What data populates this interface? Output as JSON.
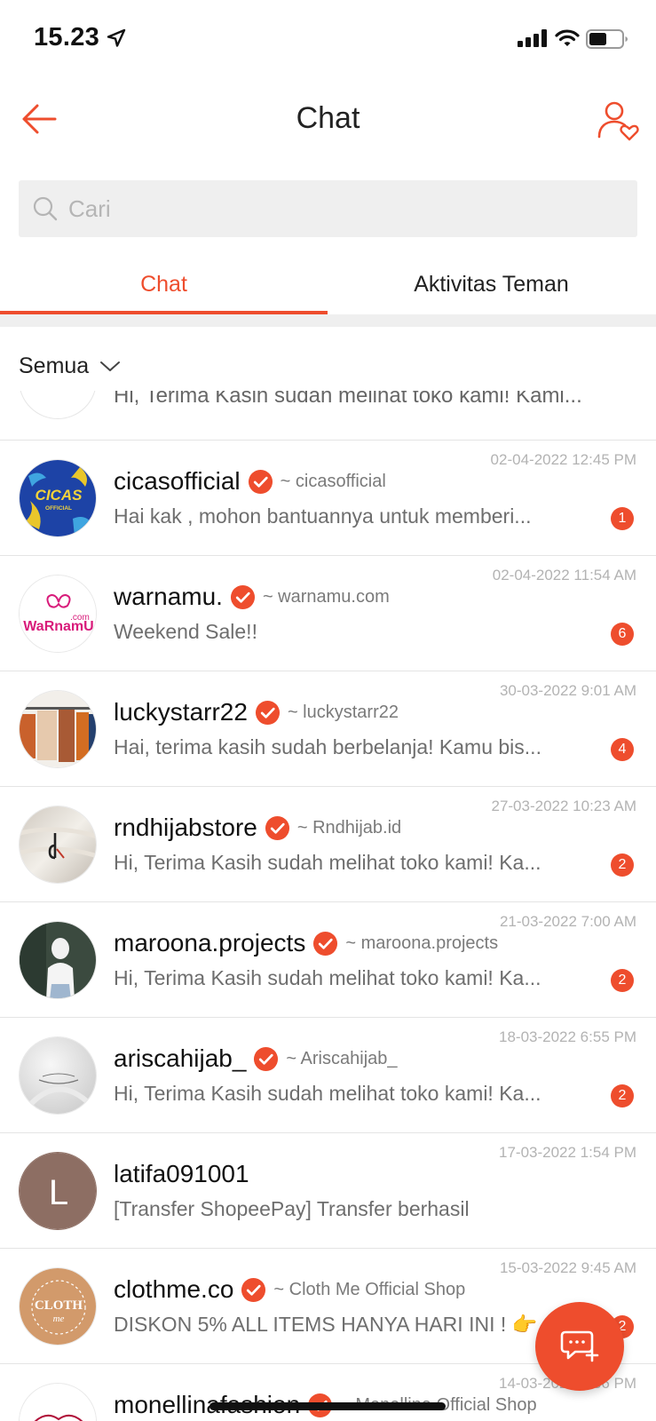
{
  "status_bar": {
    "time": "15.23",
    "icons": [
      "location-arrow-icon",
      "cellular-signal-icon",
      "wifi-icon",
      "battery-icon"
    ]
  },
  "header": {
    "title": "Chat",
    "back_icon": "arrow-left-icon",
    "contacts_icon": "user-heart-icon"
  },
  "search": {
    "placeholder": "Cari",
    "value": ""
  },
  "tabs": [
    {
      "label": "Chat",
      "active": true
    },
    {
      "label": "Aktivitas Teman",
      "active": false
    }
  ],
  "filter": {
    "label": "Semua"
  },
  "partial_row": {
    "message": "Hi, Terima Kasih sudah melihat toko kami! Kami..."
  },
  "chats": [
    {
      "name": "cicasofficial",
      "verified": true,
      "alias": "~ cicasofficial",
      "message": "Hai kak , mohon bantuannya untuk memberi...",
      "time": "02-04-2022 12:45 PM",
      "unread": "1",
      "avatar_text": "CICAS",
      "avatar_subtext": "OFFICIAL"
    },
    {
      "name": "warnamu.",
      "verified": true,
      "alias": "~ warnamu.com",
      "message": "Weekend Sale!!",
      "time": "02-04-2022 11:54 AM",
      "unread": "6",
      "avatar_text": "WaRnamU",
      "avatar_subtext": ".com"
    },
    {
      "name": "luckystarr22",
      "verified": true,
      "alias": "~ luckystarr22",
      "message": "Hai, terima kasih sudah berbelanja! Kamu bis...",
      "time": "30-03-2022 9:01 AM",
      "unread": "4",
      "avatar_text": "",
      "avatar_subtext": ""
    },
    {
      "name": "rndhijabstore",
      "verified": true,
      "alias": "~ Rndhijab.id",
      "message": "Hi, Terima Kasih sudah melihat toko kami! Ka...",
      "time": "27-03-2022 10:23 AM",
      "unread": "2",
      "avatar_text": "",
      "avatar_subtext": ""
    },
    {
      "name": "maroona.projects",
      "verified": true,
      "alias": "~ maroona.projects",
      "message": "Hi, Terima Kasih sudah melihat toko kami! Ka...",
      "time": "21-03-2022 7:00 AM",
      "unread": "2",
      "avatar_text": "",
      "avatar_subtext": ""
    },
    {
      "name": "ariscahijab_",
      "verified": true,
      "alias": "~ Ariscahijab_",
      "message": "Hi, Terima Kasih sudah melihat toko kami! Ka...",
      "time": "18-03-2022 6:55 PM",
      "unread": "2",
      "avatar_text": "",
      "avatar_subtext": ""
    },
    {
      "name": "latifa091001",
      "verified": false,
      "alias": "",
      "message": "[Transfer ShopeePay] Transfer berhasil",
      "time": "17-03-2022 1:54 PM",
      "unread": "",
      "avatar_text": "L",
      "avatar_subtext": ""
    },
    {
      "name": "clothme.co",
      "verified": true,
      "alias": "~ Cloth Me Official Shop",
      "message": "DISKON 5% ALL ITEMS HANYA HARI INI ! 👉",
      "time": "15-03-2022 9:45 AM",
      "unread": "2",
      "avatar_text": "CLOTH",
      "avatar_subtext": "me"
    },
    {
      "name": "monellinafashion",
      "verified": true,
      "alias": "~ Monellina Official Shop",
      "message": "",
      "time": "14-03-2022 3:36 PM",
      "unread": "",
      "avatar_text": "",
      "avatar_subtext": ""
    }
  ],
  "fab": {
    "icon": "new-chat-icon"
  },
  "colors": {
    "accent": "#ee4d2d",
    "muted_text": "#6e6e6e",
    "timestamp": "#b3b3b3",
    "search_bg": "#efefef",
    "divider": "#e4e4e4"
  }
}
